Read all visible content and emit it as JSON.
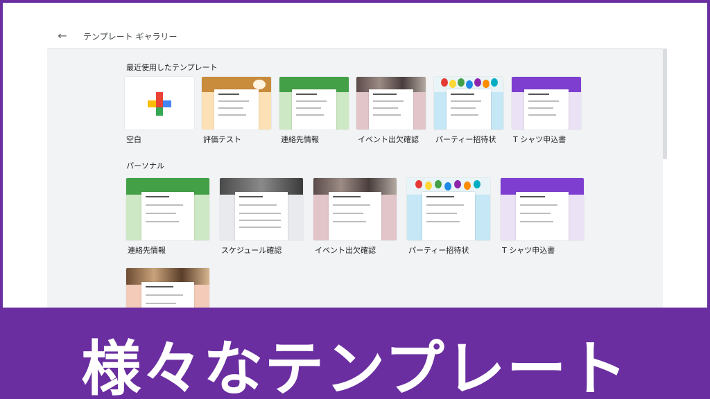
{
  "header": {
    "back_icon": "arrow-back-icon",
    "title": "テンプレート ギャラリー"
  },
  "sections": {
    "recent": {
      "title": "最近使用したテンプレート",
      "cards": [
        {
          "label": "空白"
        },
        {
          "label": "評価テスト"
        },
        {
          "label": "連絡先情報"
        },
        {
          "label": "イベント出欠確認"
        },
        {
          "label": "パーティー招待状"
        },
        {
          "label": "T シャツ申込書"
        }
      ]
    },
    "personal": {
      "title": "パーソナル",
      "cards": [
        {
          "label": "連絡先情報"
        },
        {
          "label": "スケジュール確認"
        },
        {
          "label": "イベント出欠確認"
        },
        {
          "label": "パーティー招待状"
        },
        {
          "label": "T シャツ申込書"
        }
      ]
    }
  },
  "banner": {
    "text": "様々なテンプレート"
  },
  "colors": {
    "banner": "#6a2ea0",
    "green_header": "#43a047",
    "green_bg": "#cde8c4",
    "orange_bg": "#fde1b6",
    "pink_bg": "#e2c5c8",
    "blue_bg": "#c6e7f5",
    "purple_header": "#7e3fd1",
    "purple_bg": "#ebe2f6",
    "gray_bg": "#e8eaed",
    "salmon_bg": "#f4cbb9"
  }
}
